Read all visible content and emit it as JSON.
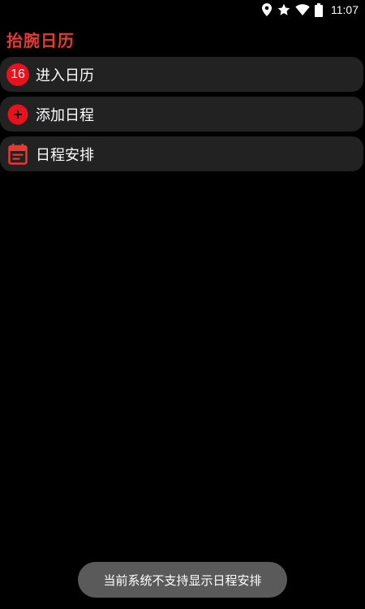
{
  "status_bar": {
    "time": "11:07",
    "icons": [
      "location-icon",
      "star-icon",
      "wifi-icon",
      "battery-icon"
    ]
  },
  "app": {
    "title": "抬腕日历",
    "accent_color": "#e53935"
  },
  "menu": {
    "items": [
      {
        "label": "进入日历",
        "icon": "calendar-badge-icon",
        "badge": "16"
      },
      {
        "label": "添加日程",
        "icon": "add-circle-icon"
      },
      {
        "label": "日程安排",
        "icon": "calendar-icon"
      }
    ]
  },
  "toast": {
    "message": "当前系统不支持显示日程安排"
  }
}
